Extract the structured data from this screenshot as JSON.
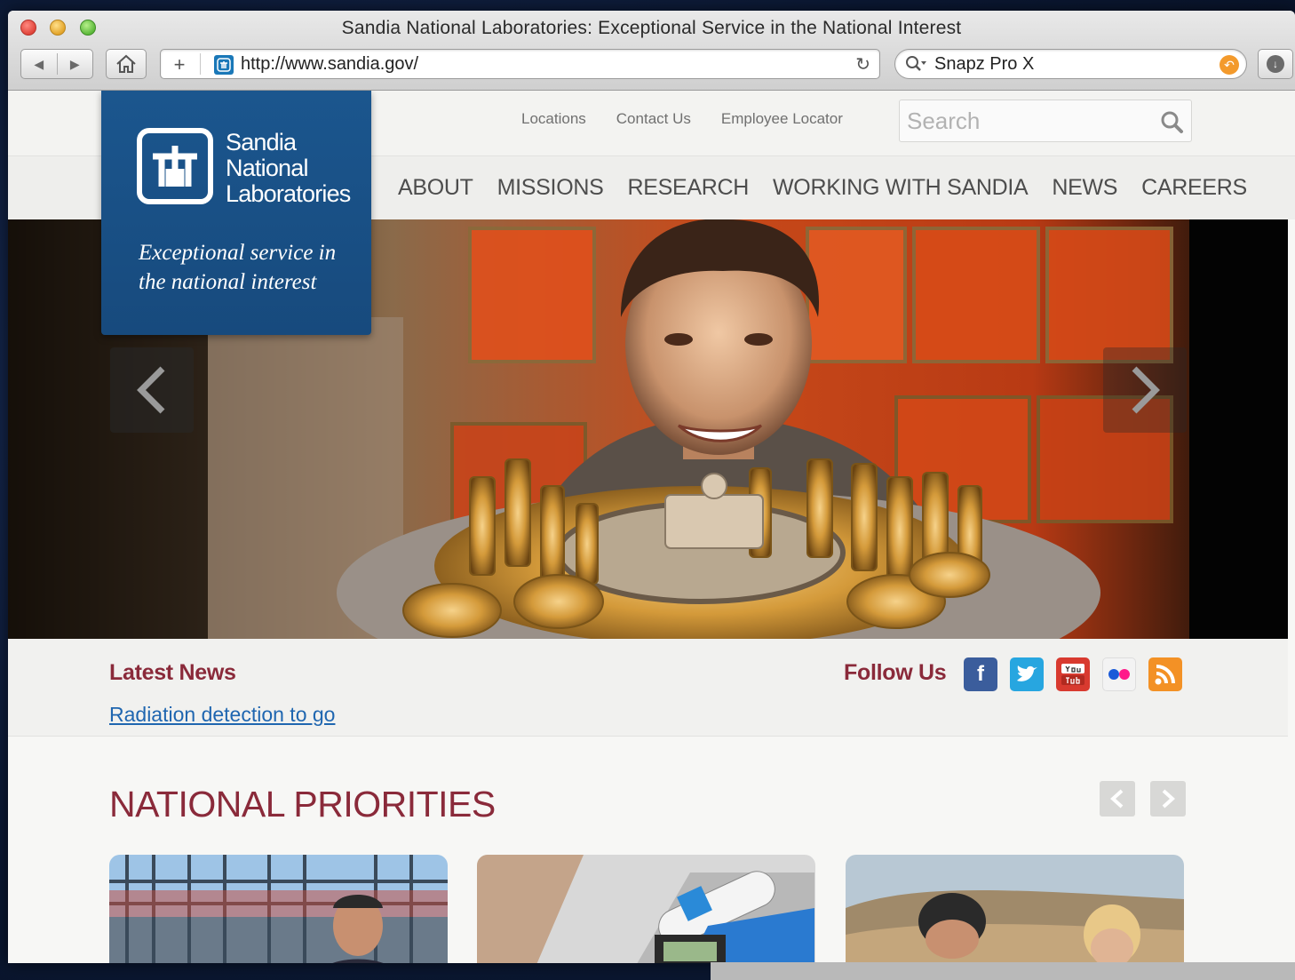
{
  "browser": {
    "window_title": "Sandia National Laboratories: Exceptional Service in the National Interest",
    "url": "http://www.sandia.gov/",
    "web_search_value": "Snapz Pro X"
  },
  "site": {
    "logo": {
      "name_lines": [
        "Sandia",
        "National",
        "Laboratories"
      ],
      "tagline": "Exceptional service in the national interest"
    },
    "utility_links": [
      "Locations",
      "Contact Us",
      "Employee Locator"
    ],
    "search_placeholder": "Search",
    "main_nav": [
      "ABOUT",
      "MISSIONS",
      "RESEARCH",
      "WORKING WITH SANDIA",
      "NEWS",
      "CAREERS"
    ],
    "latest_news": {
      "title": "Latest News",
      "headline": "Radiation detection to go"
    },
    "follow_us": {
      "title": "Follow Us",
      "networks": [
        "facebook-icon",
        "twitter-icon",
        "youtube-icon",
        "flickr-icon",
        "rss-icon"
      ]
    },
    "priorities": {
      "title": "NATIONAL PRIORITIES"
    }
  },
  "colors": {
    "brand_blue": "#1b568e",
    "heading_maroon": "#8a2a3a",
    "link_blue": "#1f66b0"
  }
}
